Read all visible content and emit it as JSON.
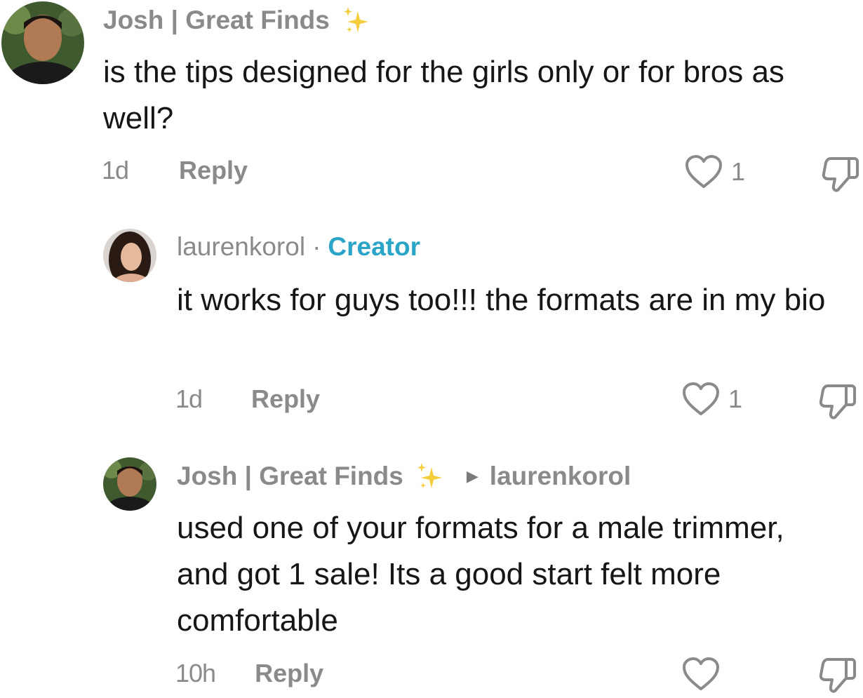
{
  "comments": [
    {
      "author": "Josh | Great Finds",
      "text": "is the tips designed for the girls only or for bros as well?",
      "time": "1d",
      "reply_label": "Reply",
      "likes": "1"
    },
    {
      "author": "laurenkorol",
      "separator": "·",
      "badge": "Creator",
      "badge_color": "#2aa4c7",
      "text": "it works for guys too!!! the formats are in my bio",
      "time": "1d",
      "reply_label": "Reply",
      "likes": "1"
    },
    {
      "author": "Josh | Great Finds",
      "reply_to": "laurenkorol",
      "text": "used one of your formats for a male trimmer, and got 1 sale! Its a good start felt more comfortable",
      "time": "10h",
      "reply_label": "Reply",
      "likes": ""
    }
  ],
  "icons": {
    "sparkle": "sparkles-icon",
    "like": "heart-outline-icon",
    "dislike": "thumbs-down-icon",
    "reply_arrow": "triangle-right-icon"
  }
}
